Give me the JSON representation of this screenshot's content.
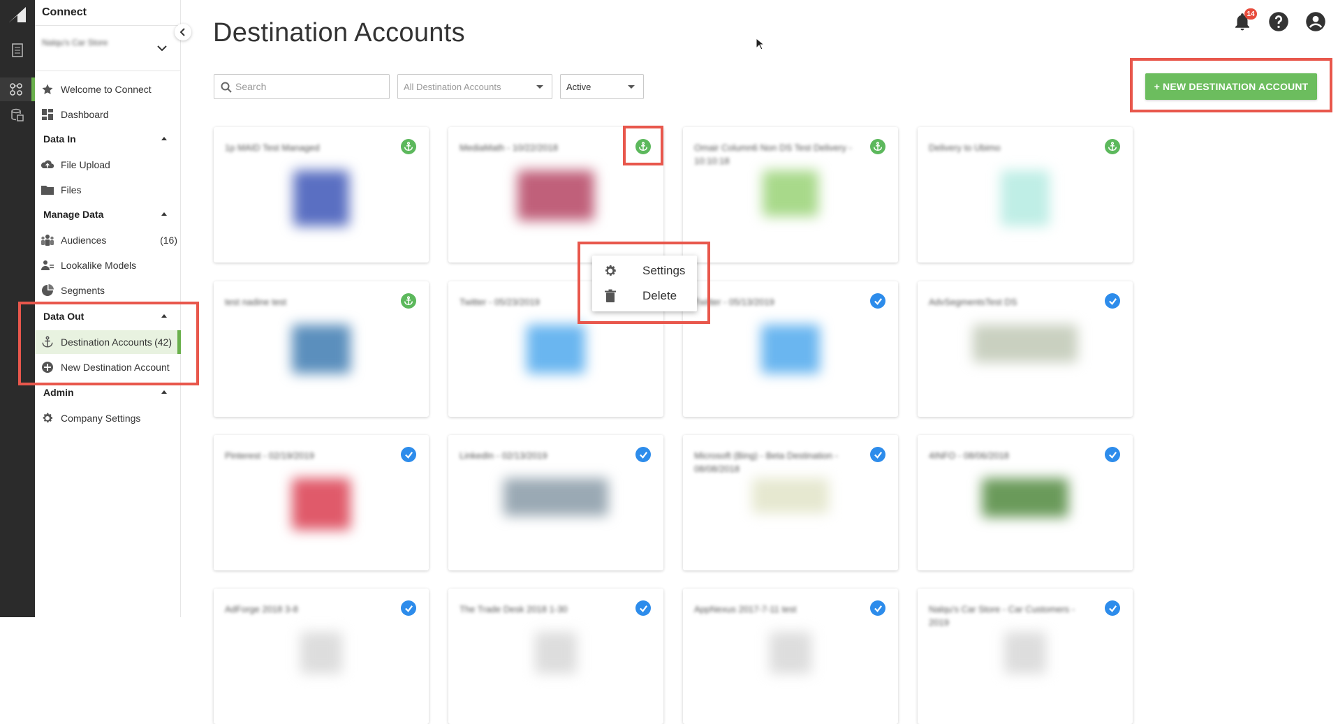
{
  "rail": {
    "items": [
      {
        "icon": "document-list-icon"
      },
      {
        "icon": "connect-nodes-icon",
        "active": true
      },
      {
        "icon": "database-stack-icon"
      }
    ]
  },
  "sidebar": {
    "title": "Connect",
    "account_name": "Nalqu's Car Store",
    "nav_top": [
      {
        "label": "Welcome to Connect",
        "icon": "star-icon"
      },
      {
        "label": "Dashboard",
        "icon": "dashboard-icon"
      }
    ],
    "sections": {
      "data_in": {
        "title": "Data In",
        "items": [
          {
            "label": "File Upload",
            "icon": "cloud-upload-icon"
          },
          {
            "label": "Files",
            "icon": "folder-icon"
          }
        ]
      },
      "manage_data": {
        "title": "Manage Data",
        "items": [
          {
            "label": "Audiences",
            "icon": "people-icon",
            "count": "(16)"
          },
          {
            "label": "Lookalike Models",
            "icon": "lookalike-icon"
          },
          {
            "label": "Segments",
            "icon": "pie-chart-icon"
          }
        ]
      },
      "data_out": {
        "title": "Data Out",
        "items": [
          {
            "label": "Destination Accounts",
            "icon": "anchor-icon",
            "count": "(42)",
            "active": true
          },
          {
            "label": "New Destination Account",
            "icon": "plus-circle-icon"
          }
        ]
      },
      "admin": {
        "title": "Admin",
        "items": [
          {
            "label": "Company Settings",
            "icon": "gear-icon"
          }
        ]
      }
    }
  },
  "header": {
    "title": "Destination Accounts",
    "notification_count": "14"
  },
  "filters": {
    "search_placeholder": "Search",
    "type_select": "All Destination Accounts",
    "status_select": "Active"
  },
  "new_button_label": "+ NEW DESTINATION ACCOUNT",
  "context_menu": {
    "settings": "Settings",
    "delete": "Delete"
  },
  "cards": [
    {
      "name": "1p MAID Test Managed",
      "status": "anchor",
      "logo_color": "#5a6fc2"
    },
    {
      "name": "MediaMath - 10/22/2018",
      "status": "anchor",
      "logo_color": "#c0607a"
    },
    {
      "name": "Omair Column6 Non DS Test Delivery - 10:10:18",
      "status": "anchor",
      "logo_color": "#a8d98a"
    },
    {
      "name": "Delivery to Ubimo",
      "status": "anchor",
      "logo_color": "#bfeee6"
    },
    {
      "name": "test nadine test",
      "status": "anchor",
      "logo_color": "#5b8fbd"
    },
    {
      "name": "Twitter - 05/23/2019",
      "status": "check",
      "logo_color": "#6ab6f0"
    },
    {
      "name": "Twitter - 05/13/2019",
      "status": "check",
      "logo_color": "#6ab6f0"
    },
    {
      "name": "AdvSegmentsTest DS",
      "status": "check",
      "logo_color": "#c9d0c0"
    },
    {
      "name": "Pinterest - 02/19/2019",
      "status": "check",
      "logo_color": "#e05a6a"
    },
    {
      "name": "LinkedIn - 02/13/2019",
      "status": "check",
      "logo_color": "#9aa9b4"
    },
    {
      "name": "Microsoft (Bing) - Beta Destination - 08/08/2018",
      "status": "check",
      "logo_color": "#e6e8d0"
    },
    {
      "name": "4INFO - 08/06/2018",
      "status": "check",
      "logo_color": "#6a9a5a"
    },
    {
      "name": "AdForge 2018 3-8",
      "status": "check",
      "logo_color": "#dddddd"
    },
    {
      "name": "The Trade Desk 2018 1-30",
      "status": "check",
      "logo_color": "#dddddd"
    },
    {
      "name": "AppNexus 2017-7-11 test",
      "status": "check",
      "logo_color": "#dddddd"
    },
    {
      "name": "Nalqu's Car Store - Car Customers - 2019",
      "status": "check",
      "logo_color": "#dddddd"
    }
  ]
}
